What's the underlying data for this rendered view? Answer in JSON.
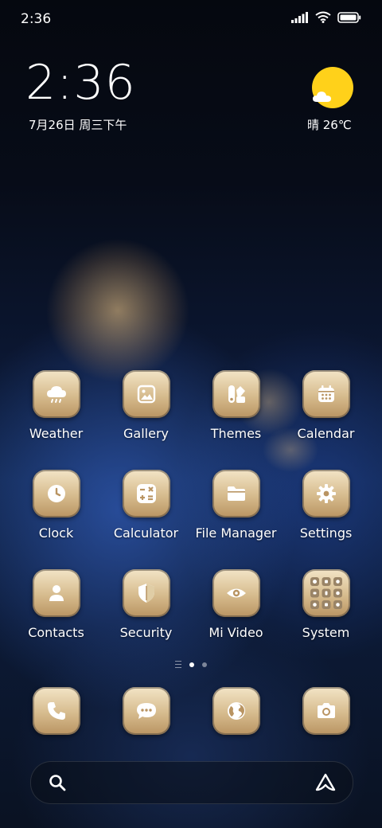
{
  "status_bar": {
    "time": "2:36"
  },
  "clock_widget": {
    "time": "2:36",
    "date": "7月26日 周三下午"
  },
  "weather_widget": {
    "text": "晴 26℃",
    "icon": "sunny-icon"
  },
  "apps": {
    "weather": {
      "label": "Weather",
      "icon": "weather-cloud-icon"
    },
    "gallery": {
      "label": "Gallery",
      "icon": "image-icon"
    },
    "themes": {
      "label": "Themes",
      "icon": "themes-icon"
    },
    "calendar": {
      "label": "Calendar",
      "icon": "calendar-icon"
    },
    "clock": {
      "label": "Clock",
      "icon": "clock-icon"
    },
    "calculator": {
      "label": "Calculator",
      "icon": "calculator-icon"
    },
    "file_manager": {
      "label": "File Manager",
      "icon": "folder-icon"
    },
    "settings": {
      "label": "Settings",
      "icon": "gear-icon"
    },
    "contacts": {
      "label": "Contacts",
      "icon": "person-icon"
    },
    "security": {
      "label": "Security",
      "icon": "shield-icon"
    },
    "mi_video": {
      "label": "Mi Video",
      "icon": "eye-icon"
    },
    "system": {
      "label": "System",
      "icon": "folder-grid-icon"
    }
  },
  "dock": [
    "phone-icon",
    "message-icon",
    "browser-globe-icon",
    "camera-icon"
  ],
  "search_bar": {
    "left_icon": "search-icon",
    "right_icon": "assistant-icon"
  }
}
